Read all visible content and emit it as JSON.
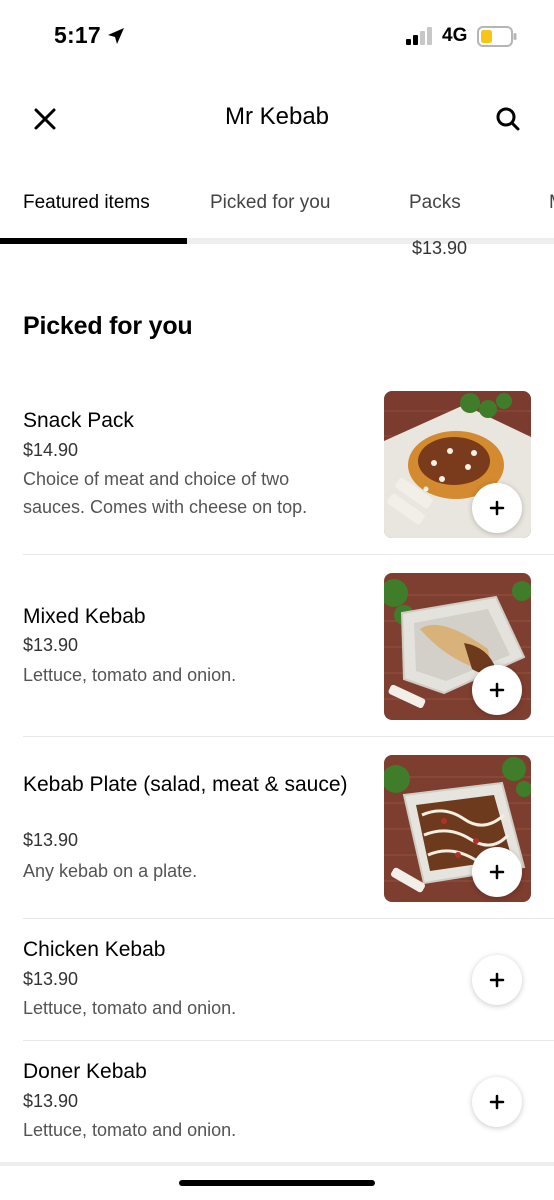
{
  "status_bar": {
    "time": "5:17",
    "network": "4G",
    "battery_color": "#f5c518",
    "icons": [
      "location-arrow-icon",
      "signal-bars-icon",
      "battery-icon"
    ]
  },
  "header": {
    "title": "Mr Kebab",
    "close_icon": "close-icon",
    "search_icon": "search-icon"
  },
  "tabs": [
    {
      "label": "Featured items",
      "active": true
    },
    {
      "label": "Picked for you",
      "active": false
    },
    {
      "label": "Packs",
      "active": false
    },
    {
      "label": "M",
      "active": false
    }
  ],
  "clipped_previous_price": "$13.90",
  "section": {
    "title": "Picked for you",
    "items": [
      {
        "name": "Snack Pack",
        "price": "$14.90",
        "description": "Choice of meat and choice of two sauces. Comes with cheese on top.",
        "has_image": true
      },
      {
        "name": "Mixed Kebab",
        "price": "$13.90",
        "description": "Lettuce, tomato and onion.",
        "has_image": true
      },
      {
        "name": "Kebab Plate (salad, meat & sauce)",
        "price": "$13.90",
        "description": "Any kebab on a plate.",
        "has_image": true
      },
      {
        "name": "Chicken Kebab",
        "price": "$13.90",
        "description": "Lettuce, tomato and onion.",
        "has_image": false
      },
      {
        "name": "Doner Kebab",
        "price": "$13.90",
        "description": "Lettuce, tomato and onion.",
        "has_image": false
      }
    ]
  },
  "add_button_icon": "plus-icon",
  "colors": {
    "accent": "#000000",
    "divider": "#e8e8e8",
    "secondary_text": "#545454"
  }
}
